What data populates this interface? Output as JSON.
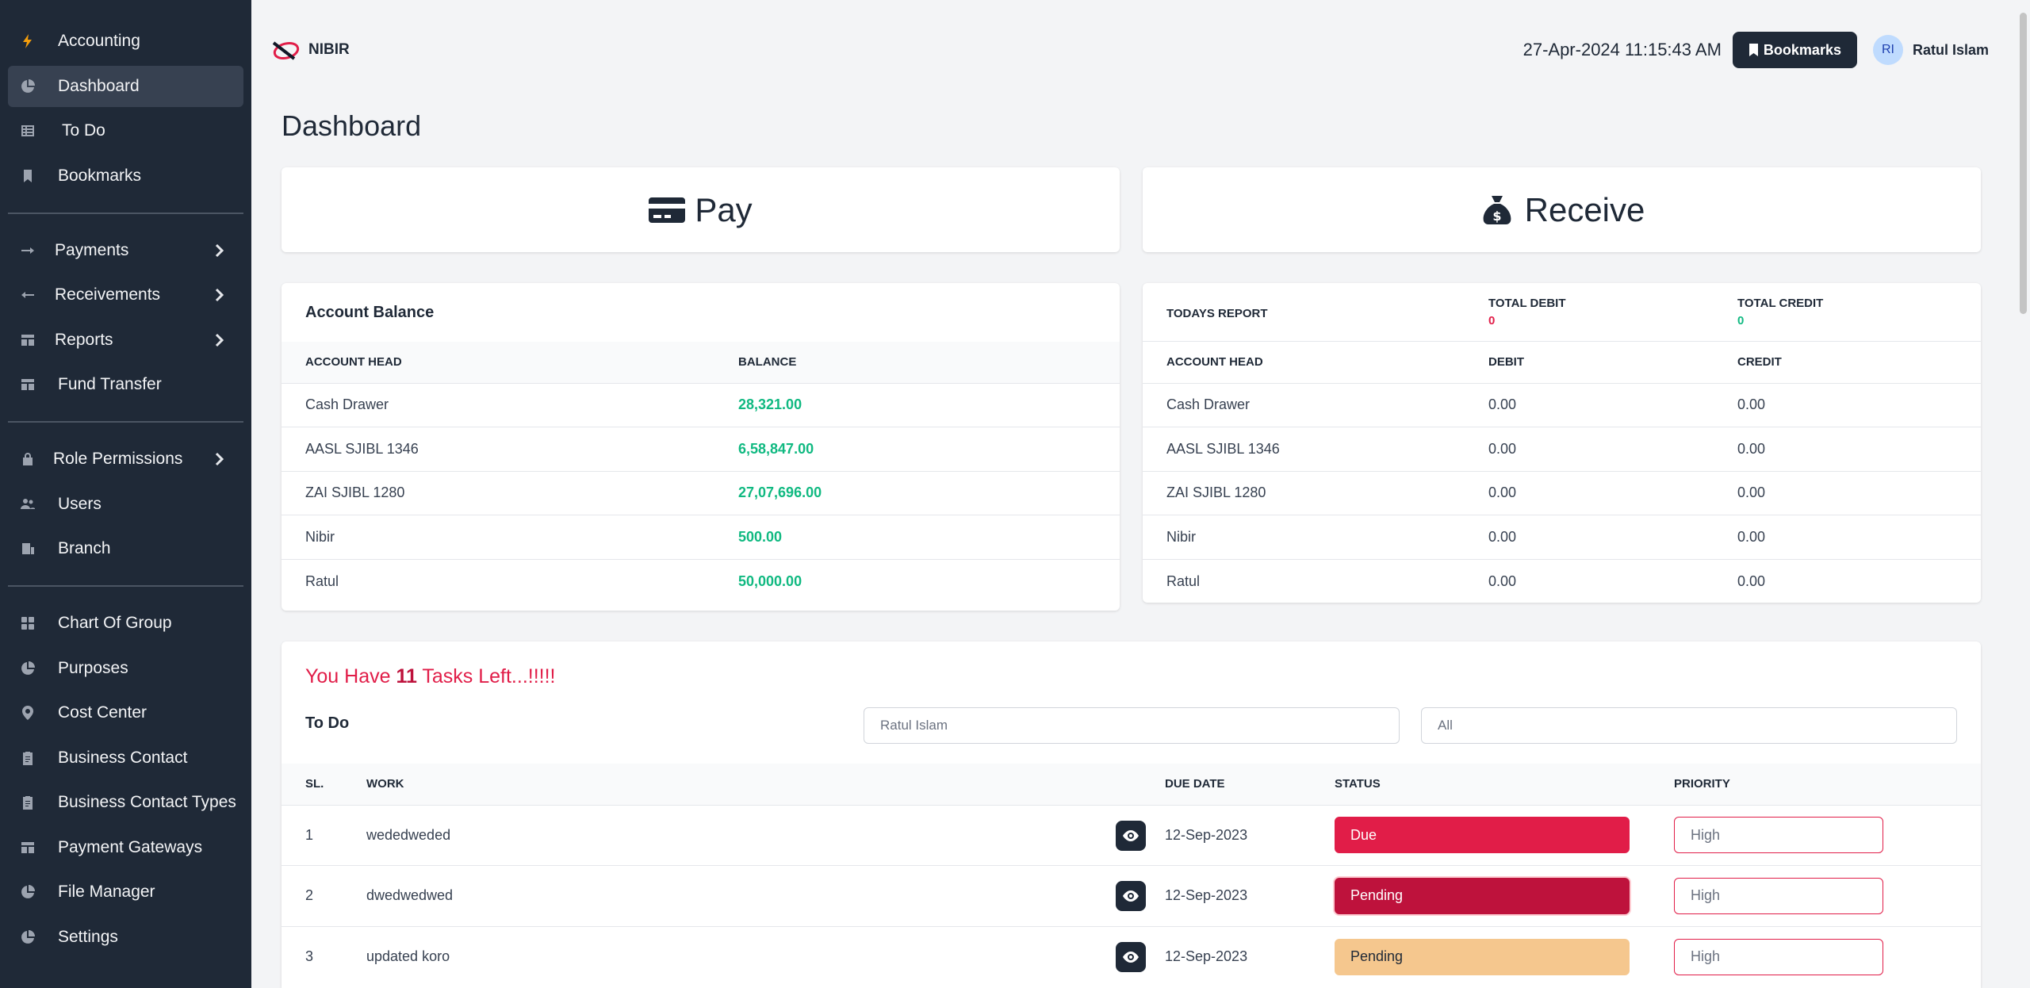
{
  "sidebar": {
    "items": [
      {
        "label": "Accounting",
        "icon": "bolt-icon"
      },
      {
        "label": "Dashboard",
        "icon": "pie-chart-icon"
      },
      {
        "label": "To Do",
        "icon": "table-icon"
      },
      {
        "label": "Bookmarks",
        "icon": "bookmark-icon"
      },
      {
        "label": "Payments",
        "icon": "arrow-right-icon"
      },
      {
        "label": "Receivements",
        "icon": "arrow-left-icon"
      },
      {
        "label": "Reports",
        "icon": "report-icon"
      },
      {
        "label": "Fund Transfer",
        "icon": "report-icon"
      },
      {
        "label": "Role Permissions",
        "icon": "lock-icon"
      },
      {
        "label": "Users",
        "icon": "users-icon"
      },
      {
        "label": "Branch",
        "icon": "building-icon"
      },
      {
        "label": "Chart Of Group",
        "icon": "grid-icon"
      },
      {
        "label": "Purposes",
        "icon": "pie-chart-icon"
      },
      {
        "label": "Cost Center",
        "icon": "location-pin-icon"
      },
      {
        "label": "Business Contact",
        "icon": "clipboard-icon"
      },
      {
        "label": "Business Contact Types",
        "icon": "clipboard-icon"
      },
      {
        "label": "Payment Gateways",
        "icon": "report-icon"
      },
      {
        "label": "File Manager",
        "icon": "pie-chart-icon"
      },
      {
        "label": "Settings",
        "icon": "pie-chart-icon"
      }
    ]
  },
  "header": {
    "brand": "NIBIR",
    "datetime": "27-Apr-2024 11:15:43 AM",
    "bookmarks_label": "Bookmarks",
    "avatar_initials": "RI",
    "user_name": "Ratul Islam"
  },
  "page_title": "Dashboard",
  "actions": {
    "pay": "Pay",
    "receive": "Receive"
  },
  "account_balance": {
    "title": "Account Balance",
    "col_head": "ACCOUNT HEAD",
    "col_balance": "BALANCE",
    "rows": [
      {
        "head": "Cash Drawer",
        "balance": "28,321.00"
      },
      {
        "head": "AASL SJIBL 1346",
        "balance": "6,58,847.00"
      },
      {
        "head": "ZAI SJIBL 1280",
        "balance": "27,07,696.00"
      },
      {
        "head": "Nibir",
        "balance": "500.00"
      },
      {
        "head": "Ratul",
        "balance": "50,000.00"
      }
    ]
  },
  "todays_report": {
    "title": "TODAYS REPORT",
    "total_debit_label": "TOTAL DEBIT",
    "total_debit": "0",
    "total_credit_label": "TOTAL CREDIT",
    "total_credit": "0",
    "col_head": "ACCOUNT HEAD",
    "col_debit": "DEBIT",
    "col_credit": "CREDIT",
    "rows": [
      {
        "head": "Cash Drawer",
        "debit": "0.00",
        "credit": "0.00"
      },
      {
        "head": "AASL SJIBL 1346",
        "debit": "0.00",
        "credit": "0.00"
      },
      {
        "head": "ZAI SJIBL 1280",
        "debit": "0.00",
        "credit": "0.00"
      },
      {
        "head": "Nibir",
        "debit": "0.00",
        "credit": "0.00"
      },
      {
        "head": "Ratul",
        "debit": "0.00",
        "credit": "0.00"
      }
    ]
  },
  "tasks": {
    "prefix": "You Have ",
    "count": "11",
    "suffix": " Tasks Left...!!!!!",
    "todo_label": "To Do",
    "user_filter": "Ratul Islam",
    "status_filter": "All",
    "col_sl": "SL.",
    "col_work": "WORK",
    "col_due": "DUE DATE",
    "col_status": "STATUS",
    "col_priority": "PRIORITY",
    "rows": [
      {
        "sl": "1",
        "work": "wededweded",
        "due": "12-Sep-2023",
        "status": "Due",
        "priority": "High"
      },
      {
        "sl": "2",
        "work": "dwedwedwed",
        "due": "12-Sep-2023",
        "status": "Pending",
        "priority": "High"
      },
      {
        "sl": "3",
        "work": "updated koro",
        "due": "12-Sep-2023",
        "status": "Pending",
        "priority": "High"
      }
    ]
  },
  "colors": {
    "sidebar_bg": "#1f2937",
    "accent_red": "#e11d48",
    "positive_green": "#10b981",
    "pending_amber": "#f5c78e"
  }
}
